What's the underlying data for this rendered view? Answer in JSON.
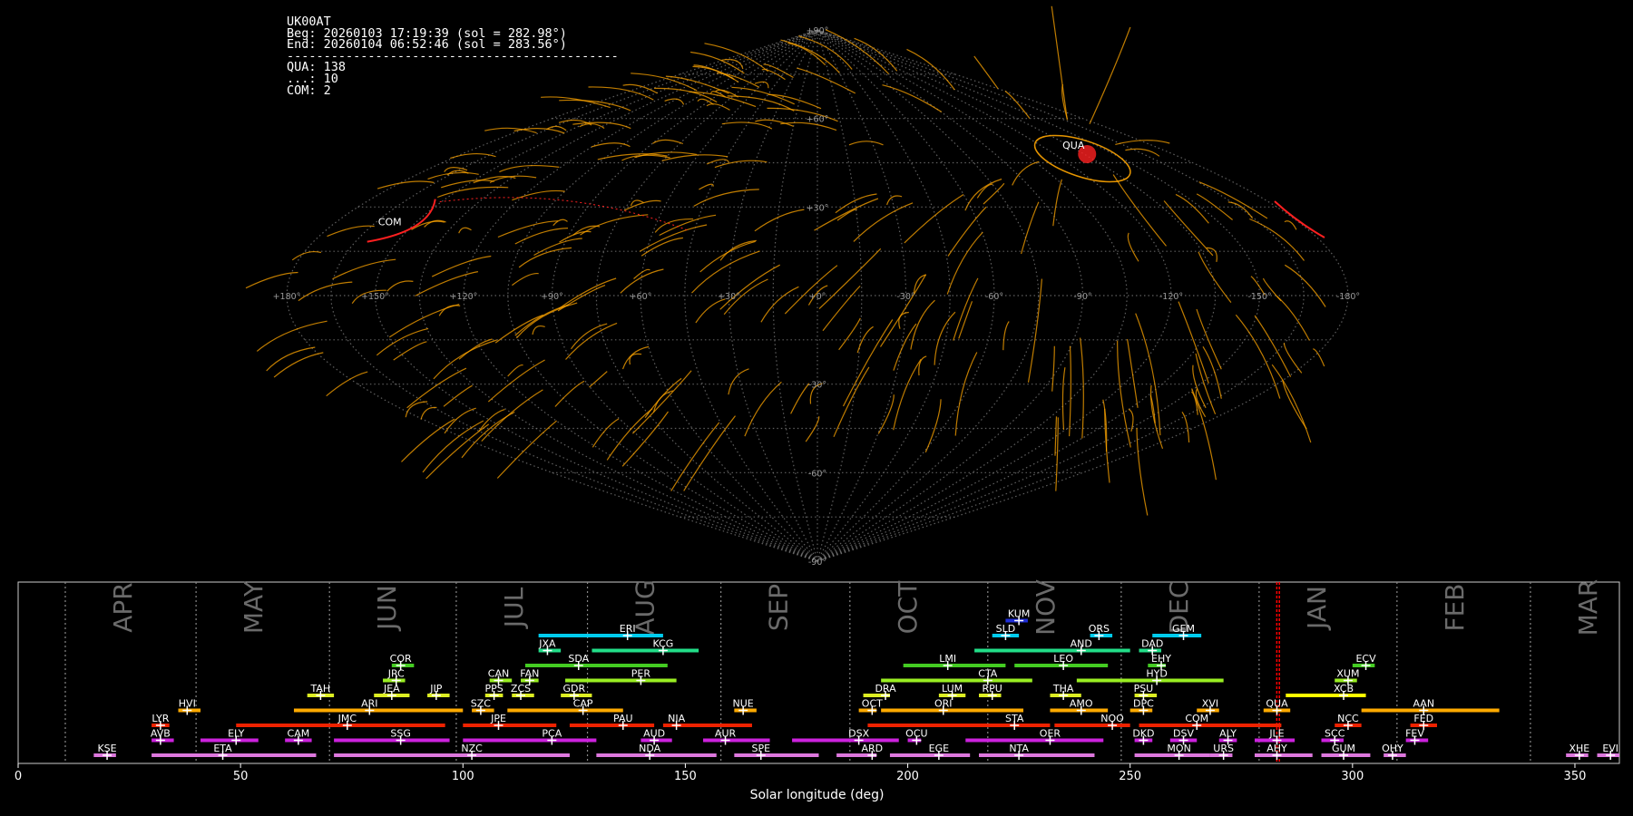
{
  "info": {
    "station": "UK00AT",
    "begin": "Beg: 20260103 17:19:39 (sol = 282.98°)",
    "end": "End: 20260104 06:52:46 (sol = 283.56°)",
    "separator": "---------------------------------------------",
    "counts": [
      "QUA: 138",
      "...: 10",
      "COM: 2"
    ]
  },
  "colors": {
    "sporadic": "#ffa500",
    "shower_track": "#ff2020",
    "grid": "#777777",
    "current_sol": "#ff0000",
    "month_label": "#6a6a6a"
  },
  "chart_data": [
    {
      "type": "scatter",
      "projection": "sinusoidal sky map",
      "lon_ticks": [
        "+180°",
        "+150°",
        "+120°",
        "+90°",
        "+60°",
        "+30°",
        "+0°",
        "-30°",
        "-60°",
        "-90°",
        "-120°",
        "-150°",
        "-180°"
      ],
      "lat_ticks": [
        "+90°",
        "+60°",
        "+30°",
        "0°",
        "-30°",
        "-60°",
        "-90°"
      ],
      "lat_grid": [
        90,
        75,
        60,
        45,
        30,
        15,
        0,
        -15,
        -30,
        -45,
        -60,
        -75,
        -90
      ],
      "radiant_labels": [
        {
          "name": "QUA",
          "lon": -138,
          "lat": 51
        },
        {
          "name": "COM",
          "lon": 160,
          "lat": 25
        }
      ]
    },
    {
      "type": "bar",
      "xlabel": "Solar longitude (deg)",
      "xlim": [
        0,
        360
      ],
      "xticks": [
        0,
        50,
        100,
        150,
        200,
        250,
        300,
        350
      ],
      "current_sol": [
        282.98,
        283.56
      ],
      "months": [
        {
          "name": "APR",
          "start": 10.6
        },
        {
          "name": "MAY",
          "start": 40.0
        },
        {
          "name": "JUN",
          "start": 70.0
        },
        {
          "name": "JUL",
          "start": 98.5
        },
        {
          "name": "AUG",
          "start": 128.0
        },
        {
          "name": "SEP",
          "start": 158.0
        },
        {
          "name": "OCT",
          "start": 187.0
        },
        {
          "name": "NOV",
          "start": 218.0
        },
        {
          "name": "DEC",
          "start": 248.0
        },
        {
          "name": "JAN",
          "start": 279.0
        },
        {
          "name": "FEB",
          "start": 310.0
        },
        {
          "name": "MAR",
          "start": 340.0
        }
      ],
      "showers": [
        {
          "name": "KUM",
          "row": 9,
          "start": 222,
          "end": 227,
          "peak": 225,
          "color": "#1f2ed8"
        },
        {
          "name": "ERI",
          "row": 8,
          "start": 117,
          "end": 145,
          "peak": 137,
          "color": "#00ccee"
        },
        {
          "name": "SLD",
          "row": 8,
          "start": 219,
          "end": 225,
          "peak": 222,
          "color": "#00ccee"
        },
        {
          "name": "ORS",
          "row": 8,
          "start": 241,
          "end": 246,
          "peak": 243,
          "color": "#00ccee"
        },
        {
          "name": "GEM",
          "row": 8,
          "start": 255,
          "end": 266,
          "peak": 262,
          "color": "#00ccee"
        },
        {
          "name": "JXA",
          "row": 7,
          "start": 117,
          "end": 122,
          "peak": 119,
          "color": "#22dd88"
        },
        {
          "name": "KCG",
          "row": 7,
          "start": 129,
          "end": 153,
          "peak": 145,
          "color": "#22dd88"
        },
        {
          "name": "AND",
          "row": 7,
          "start": 215,
          "end": 250,
          "peak": 239,
          "color": "#22dd88"
        },
        {
          "name": "DAD",
          "row": 7,
          "start": 252,
          "end": 257,
          "peak": 255,
          "color": "#22dd88"
        },
        {
          "name": "COR",
          "row": 6,
          "start": 84,
          "end": 89,
          "peak": 86,
          "color": "#44cc22"
        },
        {
          "name": "SDA",
          "row": 6,
          "start": 114,
          "end": 146,
          "peak": 126,
          "color": "#44cc22"
        },
        {
          "name": "LMI",
          "row": 6,
          "start": 199,
          "end": 222,
          "peak": 209,
          "color": "#44cc22"
        },
        {
          "name": "LEO",
          "row": 6,
          "start": 224,
          "end": 245,
          "peak": 235,
          "color": "#44cc22"
        },
        {
          "name": "EHY",
          "row": 6,
          "start": 254,
          "end": 258,
          "peak": 257,
          "color": "#44cc22"
        },
        {
          "name": "ECV",
          "row": 6,
          "start": 300,
          "end": 305,
          "peak": 303,
          "color": "#44cc22"
        },
        {
          "name": "JRC",
          "row": 5,
          "start": 82,
          "end": 87,
          "peak": 85,
          "color": "#99ee22"
        },
        {
          "name": "CAN",
          "row": 5,
          "start": 106,
          "end": 111,
          "peak": 108,
          "color": "#99ee22"
        },
        {
          "name": "FAN",
          "row": 5,
          "start": 113,
          "end": 117,
          "peak": 115,
          "color": "#99ee22"
        },
        {
          "name": "PER",
          "row": 5,
          "start": 123,
          "end": 148,
          "peak": 140,
          "color": "#99ee22"
        },
        {
          "name": "CTA",
          "row": 5,
          "start": 194,
          "end": 228,
          "peak": 218,
          "color": "#99ee22"
        },
        {
          "name": "HYD",
          "row": 5,
          "start": 238,
          "end": 271,
          "peak": 256,
          "color": "#99ee22"
        },
        {
          "name": "XUM",
          "row": 5,
          "start": 296,
          "end": 301,
          "peak": 299,
          "color": "#99ee22"
        },
        {
          "name": "TAH",
          "row": 4,
          "start": 65,
          "end": 71,
          "peak": 68,
          "color": "#ddee22"
        },
        {
          "name": "JEA",
          "row": 4,
          "start": 80,
          "end": 88,
          "peak": 84,
          "color": "#ddee22"
        },
        {
          "name": "JIP",
          "row": 4,
          "start": 92,
          "end": 97,
          "peak": 94,
          "color": "#ddee22"
        },
        {
          "name": "PPS",
          "row": 4,
          "start": 105,
          "end": 109,
          "peak": 107,
          "color": "#ddee22"
        },
        {
          "name": "ZCS",
          "row": 4,
          "start": 111,
          "end": 116,
          "peak": 113,
          "color": "#ddee22"
        },
        {
          "name": "GDR",
          "row": 4,
          "start": 122,
          "end": 129,
          "peak": 125,
          "color": "#ddee22"
        },
        {
          "name": "DRA",
          "row": 4,
          "start": 190,
          "end": 196,
          "peak": 195,
          "color": "#ddee22"
        },
        {
          "name": "LUM",
          "row": 4,
          "start": 207,
          "end": 213,
          "peak": 210,
          "color": "#ddee22"
        },
        {
          "name": "RPU",
          "row": 4,
          "start": 216,
          "end": 221,
          "peak": 219,
          "color": "#ddee22"
        },
        {
          "name": "THA",
          "row": 4,
          "start": 232,
          "end": 239,
          "peak": 235,
          "color": "#ddee22"
        },
        {
          "name": "PSU",
          "row": 4,
          "start": 251,
          "end": 256,
          "peak": 253,
          "color": "#ddee22"
        },
        {
          "name": "XCB",
          "row": 4,
          "start": 285,
          "end": 303,
          "peak": 298,
          "color": "#ffff00"
        },
        {
          "name": "HVI",
          "row": 3,
          "start": 36,
          "end": 41,
          "peak": 38,
          "color": "#ffaa00"
        },
        {
          "name": "ARI",
          "row": 3,
          "start": 62,
          "end": 100,
          "peak": 79,
          "color": "#ffaa00"
        },
        {
          "name": "SZC",
          "row": 3,
          "start": 102,
          "end": 107,
          "peak": 104,
          "color": "#ffaa00"
        },
        {
          "name": "CAP",
          "row": 3,
          "start": 110,
          "end": 136,
          "peak": 127,
          "color": "#ffaa00"
        },
        {
          "name": "NUE",
          "row": 3,
          "start": 161,
          "end": 166,
          "peak": 163,
          "color": "#ffaa00"
        },
        {
          "name": "OCT",
          "row": 3,
          "start": 189,
          "end": 193,
          "peak": 192,
          "color": "#ffaa00"
        },
        {
          "name": "ORI",
          "row": 3,
          "start": 194,
          "end": 226,
          "peak": 208,
          "color": "#ffaa00"
        },
        {
          "name": "AMO",
          "row": 3,
          "start": 232,
          "end": 245,
          "peak": 239,
          "color": "#ffaa00"
        },
        {
          "name": "DPC",
          "row": 3,
          "start": 250,
          "end": 255,
          "peak": 253,
          "color": "#ffaa00"
        },
        {
          "name": "XVI",
          "row": 3,
          "start": 265,
          "end": 270,
          "peak": 268,
          "color": "#ffaa00"
        },
        {
          "name": "QUA",
          "row": 3,
          "start": 280,
          "end": 286,
          "peak": 283,
          "color": "#ffaa00"
        },
        {
          "name": "AAN",
          "row": 3,
          "start": 302,
          "end": 333,
          "peak": 316,
          "color": "#ffaa00"
        },
        {
          "name": "LYR",
          "row": 2,
          "start": 30,
          "end": 34,
          "peak": 32,
          "color": "#ee2200"
        },
        {
          "name": "JMC",
          "row": 2,
          "start": 49,
          "end": 96,
          "peak": 74,
          "color": "#ee2200"
        },
        {
          "name": "JPE",
          "row": 2,
          "start": 100,
          "end": 121,
          "peak": 108,
          "color": "#ee2200"
        },
        {
          "name": "PAU",
          "row": 2,
          "start": 124,
          "end": 143,
          "peak": 136,
          "color": "#ee2200"
        },
        {
          "name": "NIA",
          "row": 2,
          "start": 145,
          "end": 165,
          "peak": 148,
          "color": "#ee2200"
        },
        {
          "name": "STA",
          "row": 2,
          "start": 191,
          "end": 232,
          "peak": 224,
          "color": "#ee2200"
        },
        {
          "name": "NOO",
          "row": 2,
          "start": 233,
          "end": 250,
          "peak": 246,
          "color": "#ee2200"
        },
        {
          "name": "COM",
          "row": 2,
          "start": 252,
          "end": 284,
          "peak": 265,
          "color": "#ee2200"
        },
        {
          "name": "NCC",
          "row": 2,
          "start": 296,
          "end": 302,
          "peak": 299,
          "color": "#ee2200"
        },
        {
          "name": "FED",
          "row": 2,
          "start": 313,
          "end": 319,
          "peak": 316,
          "color": "#ee2200"
        },
        {
          "name": "AVB",
          "row": 1,
          "start": 30,
          "end": 35,
          "peak": 32,
          "color": "#cc22dd"
        },
        {
          "name": "ELY",
          "row": 1,
          "start": 41,
          "end": 54,
          "peak": 49,
          "color": "#cc22dd"
        },
        {
          "name": "CAM",
          "row": 1,
          "start": 60,
          "end": 66,
          "peak": 63,
          "color": "#cc22dd"
        },
        {
          "name": "SSG",
          "row": 1,
          "start": 71,
          "end": 97,
          "peak": 86,
          "color": "#cc22dd"
        },
        {
          "name": "PCA",
          "row": 1,
          "start": 100,
          "end": 130,
          "peak": 120,
          "color": "#cc22dd"
        },
        {
          "name": "AUD",
          "row": 1,
          "start": 140,
          "end": 147,
          "peak": 143,
          "color": "#cc22dd"
        },
        {
          "name": "AUR",
          "row": 1,
          "start": 154,
          "end": 169,
          "peak": 159,
          "color": "#cc22dd"
        },
        {
          "name": "DSX",
          "row": 1,
          "start": 174,
          "end": 198,
          "peak": 189,
          "color": "#cc22dd"
        },
        {
          "name": "OCU",
          "row": 1,
          "start": 200,
          "end": 203,
          "peak": 202,
          "color": "#cc22dd"
        },
        {
          "name": "OER",
          "row": 1,
          "start": 213,
          "end": 244,
          "peak": 232,
          "color": "#cc22dd"
        },
        {
          "name": "DKD",
          "row": 1,
          "start": 251,
          "end": 255,
          "peak": 253,
          "color": "#cc22dd"
        },
        {
          "name": "DSV",
          "row": 1,
          "start": 259,
          "end": 265,
          "peak": 262,
          "color": "#cc22dd"
        },
        {
          "name": "ALY",
          "row": 1,
          "start": 270,
          "end": 274,
          "peak": 272,
          "color": "#cc22dd"
        },
        {
          "name": "JLE",
          "row": 1,
          "start": 278,
          "end": 287,
          "peak": 283,
          "color": "#cc22dd"
        },
        {
          "name": "SCC",
          "row": 1,
          "start": 293,
          "end": 298,
          "peak": 296,
          "color": "#cc22dd"
        },
        {
          "name": "FEV",
          "row": 1,
          "start": 312,
          "end": 317,
          "peak": 314,
          "color": "#cc22dd"
        },
        {
          "name": "KSE",
          "row": 0,
          "start": 17,
          "end": 22,
          "peak": 20,
          "color": "#dd77dd"
        },
        {
          "name": "ETA",
          "row": 0,
          "start": 30,
          "end": 67,
          "peak": 46,
          "color": "#dd77dd"
        },
        {
          "name": "NZC",
          "row": 0,
          "start": 71,
          "end": 124,
          "peak": 102,
          "color": "#dd77dd"
        },
        {
          "name": "NDA",
          "row": 0,
          "start": 130,
          "end": 157,
          "peak": 142,
          "color": "#dd77dd"
        },
        {
          "name": "SPE",
          "row": 0,
          "start": 161,
          "end": 180,
          "peak": 167,
          "color": "#dd77dd"
        },
        {
          "name": "ARD",
          "row": 0,
          "start": 184,
          "end": 193,
          "peak": 192,
          "color": "#dd77dd"
        },
        {
          "name": "EGE",
          "row": 0,
          "start": 196,
          "end": 214,
          "peak": 207,
          "color": "#dd77dd"
        },
        {
          "name": "NTA",
          "row": 0,
          "start": 216,
          "end": 242,
          "peak": 225,
          "color": "#dd77dd"
        },
        {
          "name": "MON",
          "row": 0,
          "start": 251,
          "end": 268,
          "peak": 261,
          "color": "#dd77dd"
        },
        {
          "name": "URS",
          "row": 0,
          "start": 268,
          "end": 273,
          "peak": 271,
          "color": "#dd77dd"
        },
        {
          "name": "AHY",
          "row": 0,
          "start": 278,
          "end": 291,
          "peak": 283,
          "color": "#dd77dd"
        },
        {
          "name": "GUM",
          "row": 0,
          "start": 293,
          "end": 304,
          "peak": 298,
          "color": "#dd77dd"
        },
        {
          "name": "OHY",
          "row": 0,
          "start": 307,
          "end": 312,
          "peak": 309,
          "color": "#dd77dd"
        },
        {
          "name": "XHE",
          "row": 0,
          "start": 348,
          "end": 353,
          "peak": 351,
          "color": "#dd77dd"
        },
        {
          "name": "EVI",
          "row": 0,
          "start": 355,
          "end": 360,
          "peak": 358,
          "color": "#dd77dd"
        }
      ]
    }
  ]
}
